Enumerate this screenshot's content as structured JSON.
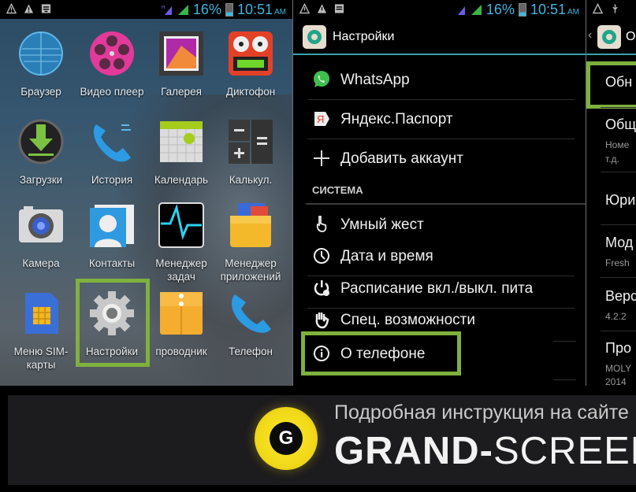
{
  "status_bar": {
    "left_icons": [
      "warning-icon",
      "warning-icon",
      "notification-icon"
    ],
    "network_type": "H",
    "battery_percent": "16%",
    "time": "10:51",
    "ampm": "AM"
  },
  "home_screen": {
    "apps": [
      {
        "label": "Браузер",
        "icon": "browser-globe-icon"
      },
      {
        "label": "Видео плеер",
        "icon": "video-reel-icon"
      },
      {
        "label": "Галерея",
        "icon": "gallery-icon"
      },
      {
        "label": "Диктофон",
        "icon": "recorder-icon"
      },
      {
        "label": "Загрузки",
        "icon": "download-icon"
      },
      {
        "label": "История",
        "icon": "call-history-icon"
      },
      {
        "label": "Календарь",
        "icon": "calendar-icon"
      },
      {
        "label": "Калькул.",
        "icon": "calculator-icon"
      },
      {
        "label": "Камера",
        "icon": "camera-icon"
      },
      {
        "label": "Контакты",
        "icon": "contacts-icon"
      },
      {
        "label": "Менеджер задач",
        "icon": "task-manager-icon"
      },
      {
        "label": "Менеджер приложений",
        "icon": "app-manager-icon"
      },
      {
        "label": "Меню SIM-карты",
        "icon": "sim-card-icon"
      },
      {
        "label": "Настройки",
        "icon": "settings-gear-icon",
        "highlighted": true
      },
      {
        "label": "проводник",
        "icon": "file-explorer-icon"
      },
      {
        "label": "Телефон",
        "icon": "phone-icon"
      }
    ]
  },
  "settings_screen": {
    "title": "Настройки",
    "accounts": [
      {
        "label": "WhatsApp",
        "icon": "whatsapp-icon"
      },
      {
        "label": "Яндекс.Паспорт",
        "icon": "yandex-icon"
      },
      {
        "label": "Добавить аккаунт",
        "icon": "plus-icon"
      }
    ],
    "section_label": "СИСТЕМА",
    "system_items": [
      {
        "label": "Умный жест",
        "icon": "gesture-hand-icon"
      },
      {
        "label": "Дата и время",
        "icon": "clock-icon"
      },
      {
        "label": "Расписание вкл./выкл. пита",
        "icon": "power-schedule-icon"
      },
      {
        "label": "Спец. возможности",
        "icon": "accessibility-hand-icon"
      },
      {
        "label": "О телефоне",
        "icon": "info-icon",
        "highlighted": true
      }
    ]
  },
  "about_screen": {
    "title_partial": "О",
    "items": [
      {
        "title": "Обн",
        "highlighted": true
      },
      {
        "title": "Общ",
        "subtitle": "Номе",
        "subtitle2": "т.д."
      },
      {
        "title": "Юри"
      },
      {
        "title": "Мод",
        "subtitle": "Fresh"
      },
      {
        "title": "Верс",
        "subtitle": "4.2.2"
      },
      {
        "title": "Про",
        "subtitle": "MOLY",
        "subtitle2": "2014"
      }
    ]
  },
  "banner": {
    "subtitle": "Подробная инструкция на сайте",
    "brand_bold": "GRAND-",
    "brand_light": "SCREEN",
    "logo_letter": "G"
  },
  "colors": {
    "highlight": "#7fb13d",
    "status_text": "#3fb6e0",
    "logo_yellow": "#f2da1a"
  }
}
